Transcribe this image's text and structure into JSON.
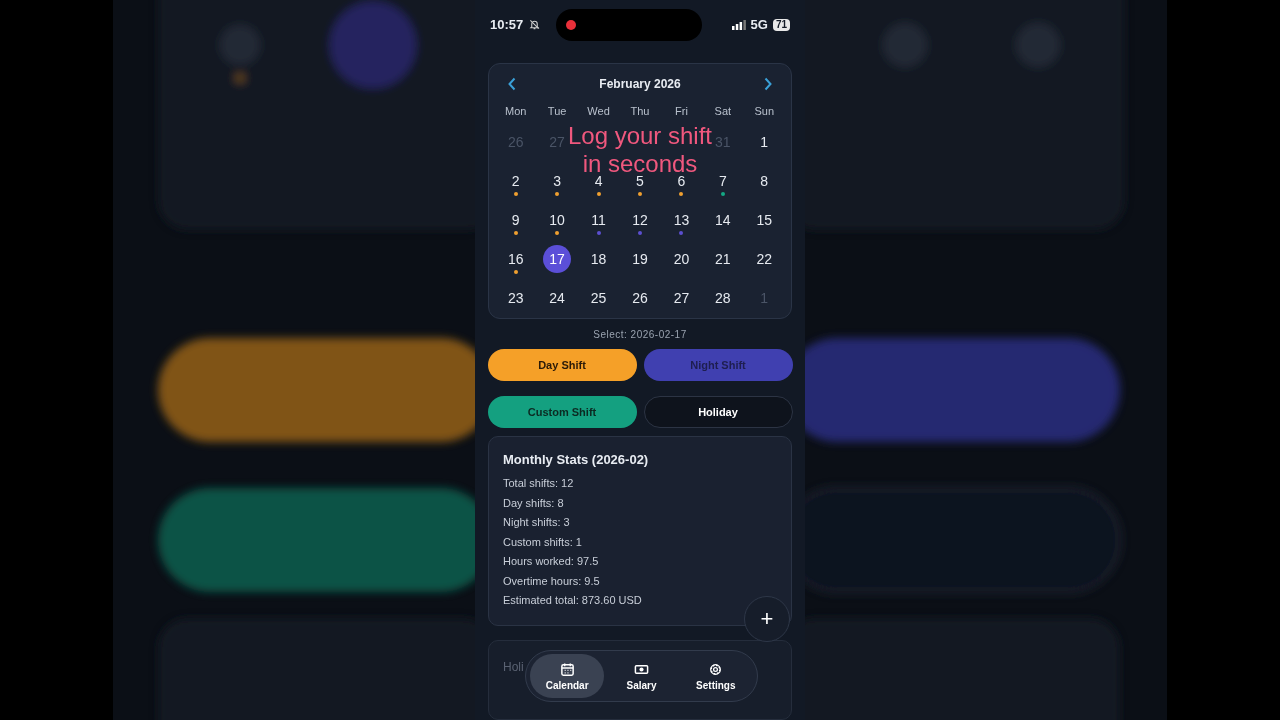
{
  "status_bar": {
    "time": "10:57",
    "network": "5G",
    "battery": "71"
  },
  "calendar": {
    "month": "February 2026",
    "weekdays": [
      "Mon",
      "Tue",
      "Wed",
      "Thu",
      "Fri",
      "Sat",
      "Sun"
    ],
    "weeks": [
      [
        {
          "kind": "day",
          "day": "26",
          "muted": true,
          "selected": false
        },
        {
          "kind": "day",
          "day": "27",
          "muted": true,
          "selected": false
        },
        {
          "kind": "covered"
        },
        {
          "kind": "covered"
        },
        {
          "kind": "covered"
        },
        {
          "kind": "day",
          "day": "31",
          "muted": true,
          "selected": false
        },
        {
          "kind": "day",
          "day": "1",
          "muted": false,
          "selected": false
        }
      ],
      [
        {
          "kind": "day",
          "day": "2",
          "muted": false,
          "selected": false,
          "color": "#f0a030"
        },
        {
          "kind": "day",
          "day": "3",
          "muted": false,
          "selected": false,
          "color": "#f0a030"
        },
        {
          "kind": "day",
          "day": "4",
          "muted": false,
          "selected": false,
          "color": "#f0a030"
        },
        {
          "kind": "day",
          "day": "5",
          "muted": false,
          "selected": false,
          "color": "#f0a030"
        },
        {
          "kind": "day",
          "day": "6",
          "muted": false,
          "selected": false,
          "color": "#f0a030"
        },
        {
          "kind": "day",
          "day": "7",
          "muted": false,
          "selected": false,
          "color": "#14a884"
        },
        {
          "kind": "day",
          "day": "8",
          "muted": false,
          "selected": false
        }
      ],
      [
        {
          "kind": "day",
          "day": "9",
          "muted": false,
          "selected": false,
          "color": "#f0a030"
        },
        {
          "kind": "day",
          "day": "10",
          "muted": false,
          "selected": false,
          "color": "#f0a030"
        },
        {
          "kind": "day",
          "day": "11",
          "muted": false,
          "selected": false,
          "color": "#5b4fd0"
        },
        {
          "kind": "day",
          "day": "12",
          "muted": false,
          "selected": false,
          "color": "#5b4fd0"
        },
        {
          "kind": "day",
          "day": "13",
          "muted": false,
          "selected": false,
          "color": "#5b4fd0"
        },
        {
          "kind": "day",
          "day": "14",
          "muted": false,
          "selected": false
        },
        {
          "kind": "day",
          "day": "15",
          "muted": false,
          "selected": false
        }
      ],
      [
        {
          "kind": "day",
          "day": "16",
          "muted": false,
          "selected": false,
          "color": "#f0a030"
        },
        {
          "kind": "day",
          "day": "17",
          "muted": false,
          "selected": true
        },
        {
          "kind": "day",
          "day": "18",
          "muted": false,
          "selected": false
        },
        {
          "kind": "day",
          "day": "19",
          "muted": false,
          "selected": false
        },
        {
          "kind": "day",
          "day": "20",
          "muted": false,
          "selected": false
        },
        {
          "kind": "day",
          "day": "21",
          "muted": false,
          "selected": false
        },
        {
          "kind": "day",
          "day": "22",
          "muted": false,
          "selected": false
        }
      ],
      [
        {
          "kind": "day",
          "day": "23",
          "muted": false,
          "selected": false
        },
        {
          "kind": "day",
          "day": "24",
          "muted": false,
          "selected": false
        },
        {
          "kind": "day",
          "day": "25",
          "muted": false,
          "selected": false
        },
        {
          "kind": "day",
          "day": "26",
          "muted": false,
          "selected": false
        },
        {
          "kind": "day",
          "day": "27",
          "muted": false,
          "selected": false
        },
        {
          "kind": "day",
          "day": "28",
          "muted": false,
          "selected": false
        },
        {
          "kind": "day",
          "day": "1",
          "muted": true,
          "selected": false
        }
      ]
    ]
  },
  "caption": [
    "Log your shift",
    "in seconds"
  ],
  "selection": "Select: 2026-02-17",
  "shift_buttons": [
    {
      "label": "Day Shift",
      "kind": "day"
    },
    {
      "label": "Night Shift",
      "kind": "night"
    },
    {
      "label": "Custom Shift",
      "kind": "custom"
    },
    {
      "label": "Holiday",
      "kind": "holiday"
    }
  ],
  "stats": {
    "title": "Monthly Stats (2026-02)",
    "lines": [
      "Total shifts: 12",
      "Day shifts: 8",
      "Night shifts: 3",
      "Custom shifts: 1",
      "Hours worked: 97.5",
      "Overtime hours: 9.5",
      "Estimated total: 873.60 USD"
    ]
  },
  "fab": "+",
  "holiday_card": {
    "title": "Holi"
  },
  "nav": [
    {
      "label": "Calendar",
      "selected": true
    },
    {
      "label": "Salary",
      "selected": false
    },
    {
      "label": "Settings",
      "selected": false
    }
  ]
}
